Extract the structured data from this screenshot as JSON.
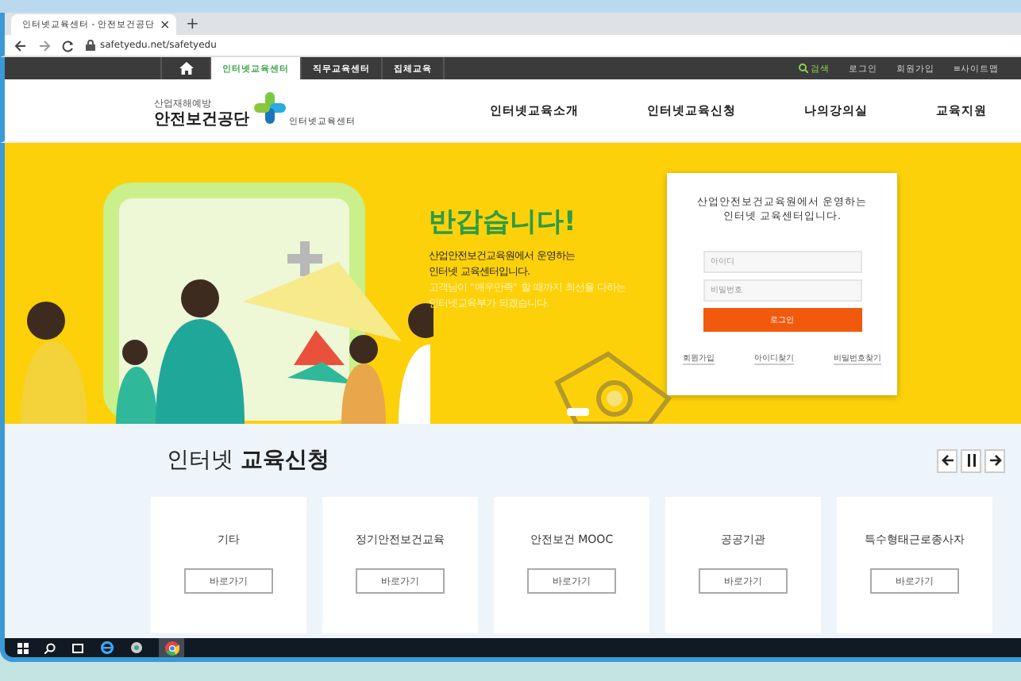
{
  "browser": {
    "tab_title": "인터넷교육센터 - 안전보건공단",
    "close": "×",
    "new_tab": "+",
    "url": "safetyedu.net/safetyedu"
  },
  "topbar": {
    "tabs": [
      {
        "label": "인터넷교육센터",
        "selected": true
      },
      {
        "label": "직무교육센터",
        "selected": false
      },
      {
        "label": "집체교육",
        "selected": false
      }
    ],
    "links": [
      {
        "label": "검색",
        "kind": "search"
      },
      {
        "label": "로그인",
        "kind": "link"
      },
      {
        "label": "회원가입",
        "kind": "link"
      },
      {
        "label": "≡사이트맵",
        "kind": "link"
      }
    ]
  },
  "header": {
    "logo_small": "산업재해예방",
    "logo_main": "안전보건공단",
    "logo_sub": "인터넷교육센터",
    "nav": [
      "인터넷교육소개",
      "인터넷교육신청",
      "나의강의실",
      "교육지원"
    ]
  },
  "hero": {
    "title": "반갑습니다!",
    "lines": [
      {
        "text": "산업안전보건교육원에서 운영하는",
        "kind": "dark"
      },
      {
        "text": "인터넷 교육센터입니다.",
        "kind": "dark"
      },
      {
        "text": "고객님이 \"매우만족\" 할 때까지 최선을 다하는",
        "kind": "muted"
      },
      {
        "text": "인터넷교육부가 되겠습니다.",
        "kind": "muted"
      }
    ]
  },
  "login": {
    "heading": [
      "산업안전보건교육원에서 운영하는",
      "인터넷 교육센터입니다."
    ],
    "id_placeholder": "아이디",
    "pw_placeholder": "비밀번호",
    "button": "로그인",
    "links": [
      "회원가입",
      "아이디찾기",
      "비밀번호찾기"
    ]
  },
  "section": {
    "title": "인터넷 **교육신청**",
    "cards": [
      {
        "name": "기타",
        "button": "바로가기"
      },
      {
        "name": "정기안전보건교육",
        "button": "바로가기"
      },
      {
        "name": "안전보건 MOOC",
        "button": "바로가기"
      },
      {
        "name": "공공기관",
        "button": "바로가기"
      },
      {
        "name": "특수형태근로종사자",
        "button": "바로가기"
      }
    ]
  }
}
